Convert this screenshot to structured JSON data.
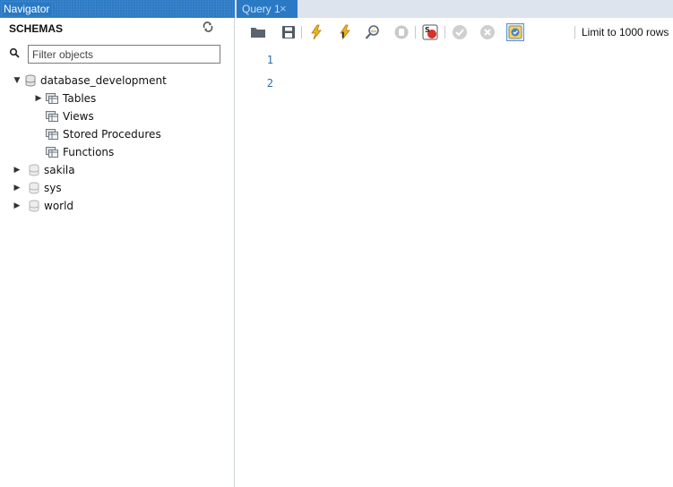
{
  "navigator": {
    "title": "Navigator",
    "schemas_label": "SCHEMAS",
    "filter_placeholder": "Filter objects",
    "tree": {
      "database_development": {
        "label": "database_development",
        "children": {
          "tables": "Tables",
          "views": "Views",
          "stored_procedures": "Stored Procedures",
          "functions": "Functions"
        }
      },
      "sakila": "sakila",
      "sys": "sys",
      "world": "world"
    }
  },
  "tabs": [
    {
      "label": "Query 1",
      "close": "×"
    }
  ],
  "toolbar": {
    "limit_label": "Limit to 1000 rows",
    "icons": [
      "open-folder-icon",
      "save-icon",
      "execute-icon",
      "execute-current-icon",
      "explain-icon",
      "stop-icon",
      "toggle-error-stop-icon",
      "commit-icon",
      "rollback-icon",
      "autocommit-icon"
    ]
  },
  "editor": {
    "line_numbers": [
      "1",
      "2"
    ]
  },
  "colors": {
    "accent": "#2a79c4",
    "line_number": "#2b6ea8"
  }
}
